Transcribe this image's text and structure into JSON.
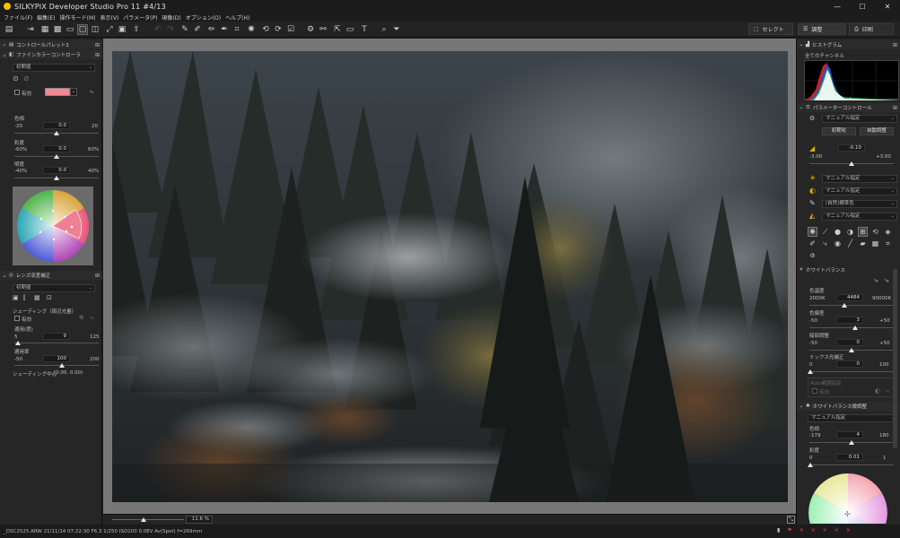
{
  "titlebar": {
    "title": "SILKYPIX Developer Studio Pro 11  #4/13",
    "min": "—",
    "max": "☐",
    "close": "✕"
  },
  "menu": [
    "ファイル(F)",
    "編集(E)",
    "操作モード(M)",
    "表示(V)",
    "パラメータ(P)",
    "現像(D)",
    "オプション(O)",
    "ヘルプ(H)"
  ],
  "toolbar": {
    "select_label": "セレクト",
    "adjust_label": "調整",
    "print_label": "印刷"
  },
  "left": {
    "control_palette_title": "コントロールパレット3",
    "fine_color_title": "ファインカラーコントローラ",
    "preset": "初期値",
    "enable_label": "有効",
    "hue_label": "色相",
    "hue_min": "-20",
    "hue_val": "0.0",
    "hue_max": "20",
    "sat_label": "彩度",
    "sat_min": "-60%",
    "sat_val": "0.0",
    "sat_max": "60%",
    "bright_label": "明度",
    "bright_min": "-40%",
    "bright_val": "0.0",
    "bright_max": "40%",
    "lens_title": "レンズ収差補正",
    "lens_preset": "初期値",
    "shading_label": "シェーディング（周辺光量）",
    "lens_enable": "有効",
    "amount_label": "適用(度)",
    "amount_min": "5",
    "amount_val": "9",
    "amount_max": "125",
    "rate_label": "適用率",
    "rate_min": "-50",
    "rate_val": "100",
    "rate_max": "200",
    "center_label": "シェーディング中心",
    "center_val": "(0.00, 0.00)"
  },
  "viewbar": {
    "zoom": "11.6 %"
  },
  "status": {
    "text": "_DSC2525.ARW 21/11/14 07:22:30 F6.3 1/250 ISO100  0.0EV Av(Spot) f=269mm"
  },
  "right": {
    "histogram_title": "ヒストグラム",
    "channel": "全てのチャンネル",
    "param_title": "パラメーターコントロール",
    "manual": "マニュアル指定",
    "init_btn": "初期化",
    "auto_btn": "自動調整",
    "exposure_val": "-0.10",
    "exposure_min": "-3.00",
    "exposure_max": "+3.00",
    "wb_combo": "マニュアル指定",
    "tone_combo": "マニュアル指定",
    "color_combo": "(自然)標準色",
    "sharp_combo": "マニュアル指定",
    "wb_title": "ホワイトバランス",
    "temp_label": "色温度",
    "temp_min": "2000K",
    "temp_val": "4484",
    "temp_max": "90000K",
    "tint_label": "色偏差",
    "tint_min": "-50",
    "tint_val": "3",
    "tint_max": "+50",
    "dark_label": "暗部調整",
    "dark_min": "-50",
    "dark_val": "0",
    "dark_max": "+50",
    "mixed_label": "ミックス光補正",
    "mixed_min": "0",
    "mixed_val": "0",
    "mixed_max": "100",
    "auto_area_label": "Auto範囲指定",
    "auto_area_enable": "有効",
    "wbfine_title": "ホワイトバランス微調整",
    "wbfine_combo": "マニュアル指定",
    "hue_label": "色相",
    "hue_min": "-179",
    "hue_val": "4",
    "hue_max": "180",
    "sat_label": "彩度",
    "sat_min": "0",
    "sat_val": "0.01",
    "sat_max": "1"
  }
}
